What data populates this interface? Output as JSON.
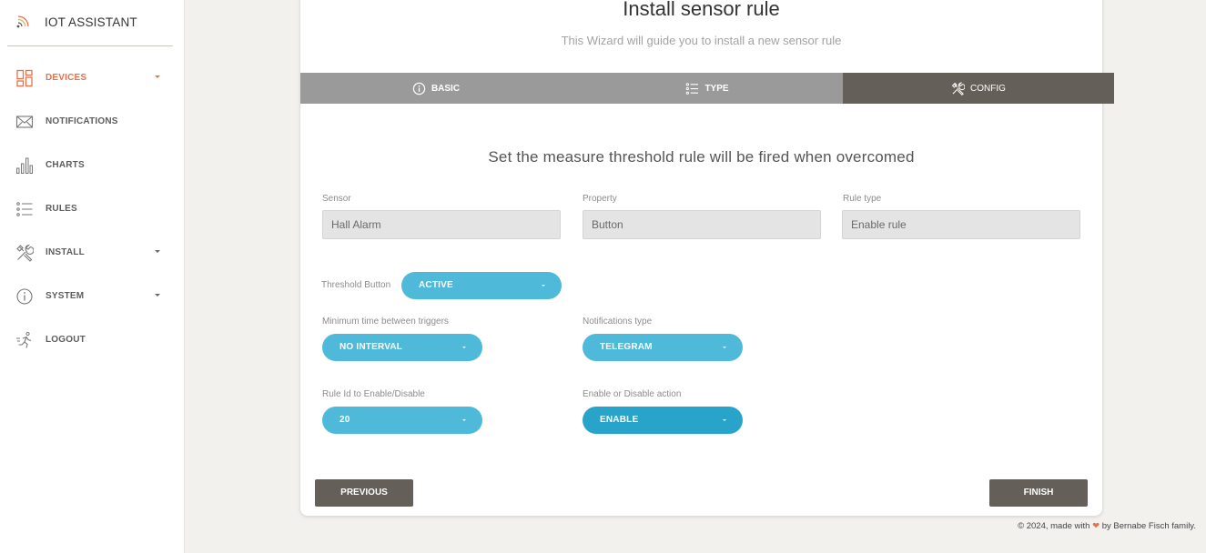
{
  "brand": {
    "name": "IOT ASSISTANT",
    "icon": "wifi-signal-icon"
  },
  "sidebar": {
    "items": [
      {
        "label": "DEVICES",
        "icon": "devices-grid-icon",
        "active": true,
        "has_caret": true
      },
      {
        "label": "NOTIFICATIONS",
        "icon": "envelope-icon",
        "active": false,
        "has_caret": false
      },
      {
        "label": "CHARTS",
        "icon": "bar-chart-icon",
        "active": false,
        "has_caret": false
      },
      {
        "label": "RULES",
        "icon": "list-icon",
        "active": false,
        "has_caret": false
      },
      {
        "label": "INSTALL",
        "icon": "tools-icon",
        "active": false,
        "has_caret": true
      },
      {
        "label": "SYSTEM",
        "icon": "info-circle-icon",
        "active": false,
        "has_caret": true
      },
      {
        "label": "LOGOUT",
        "icon": "running-person-icon",
        "active": false,
        "has_caret": false
      }
    ]
  },
  "wizard": {
    "title": "Install sensor rule",
    "subtitle": "This Wizard will guide you to install a new sensor rule",
    "steps": [
      {
        "label": "BASIC",
        "icon": "info-circle-icon",
        "active": false
      },
      {
        "label": "TYPE",
        "icon": "list-icon",
        "active": false
      },
      {
        "label": "CONFIG",
        "icon": "tools-icon",
        "active": true
      }
    ],
    "section_heading": "Set the measure threshold rule will be fired when overcomed",
    "fields": {
      "sensor": {
        "label": "Sensor",
        "value": "Hall Alarm"
      },
      "property": {
        "label": "Property",
        "value": "Button"
      },
      "rule_type": {
        "label": "Rule type",
        "value": "Enable rule"
      },
      "threshold": {
        "label": "Threshold Button",
        "value": "ACTIVE"
      },
      "min_time": {
        "label": "Minimum time between triggers",
        "value": "NO INTERVAL"
      },
      "notifications": {
        "label": "Notifications type",
        "value": "TELEGRAM"
      },
      "rule_id": {
        "label": "Rule Id to Enable/Disable",
        "value": "20"
      },
      "action": {
        "label": "Enable or Disable action",
        "value": "ENABLE"
      }
    },
    "buttons": {
      "previous": "PREVIOUS",
      "finish": "FINISH"
    }
  },
  "footer": {
    "prefix": "© 2024, made with",
    "suffix": "by Bernabe Fisch family."
  },
  "colors": {
    "accent": "#e9714a",
    "pill": "#4fb9d9",
    "pill_active": "#28a4cb",
    "step_active": "#655f59",
    "step_inactive": "#9a9a9a",
    "button": "#655f59"
  }
}
